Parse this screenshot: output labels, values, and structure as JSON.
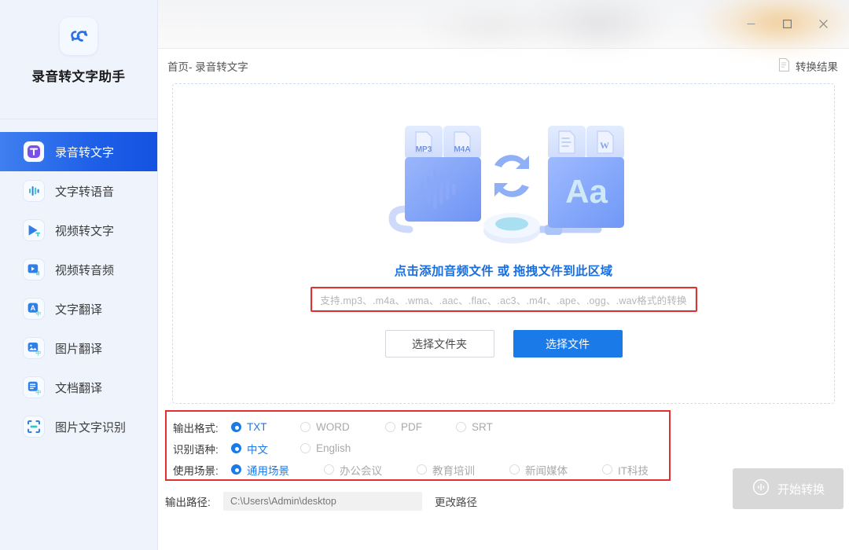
{
  "window": {
    "minimize_icon": "minimize-icon",
    "maximize_icon": "maximize-icon",
    "close_icon": "close-icon"
  },
  "sidebar": {
    "logo_icon": "app-logo-icon",
    "title": "录音转文字助手",
    "items": [
      {
        "label": "录音转文字",
        "icon": "text-transcribe-icon",
        "active": true
      },
      {
        "label": "文字转语音",
        "icon": "waveform-icon",
        "active": false
      },
      {
        "label": "视频转文字",
        "icon": "video-play-icon",
        "active": false
      },
      {
        "label": "视频转音频",
        "icon": "video-audio-icon",
        "active": false
      },
      {
        "label": "文字翻译",
        "icon": "translate-a-icon",
        "active": false
      },
      {
        "label": "图片翻译",
        "icon": "image-translate-icon",
        "active": false
      },
      {
        "label": "文档翻译",
        "icon": "doc-translate-icon",
        "active": false
      },
      {
        "label": "图片文字识别",
        "icon": "scan-ocr-icon",
        "active": false
      }
    ]
  },
  "header": {
    "breadcrumb": "首页- 录音转文字",
    "result_label": "转换结果",
    "result_icon": "document-icon"
  },
  "dropzone": {
    "illustration_labels": {
      "source_1": "MP3",
      "source_2": "M4A",
      "target_1": "doc",
      "target_2": "W",
      "target_text": "Aa"
    },
    "title": "点击添加音频文件 或 拖拽文件到此区域",
    "hint": "支持.mp3、.m4a、.wma、.aac、.flac、.ac3、.m4r、.ape、.ogg、.wav格式的转换",
    "folder_button": "选择文件夹",
    "file_button": "选择文件"
  },
  "options": {
    "format": {
      "label": "输出格式:",
      "choices": [
        {
          "label": "TXT",
          "selected": true,
          "dim": false
        },
        {
          "label": "WORD",
          "selected": false,
          "dim": true
        },
        {
          "label": "PDF",
          "selected": false,
          "dim": true
        },
        {
          "label": "SRT",
          "selected": false,
          "dim": true
        }
      ]
    },
    "language": {
      "label": "识别语种:",
      "choices": [
        {
          "label": "中文",
          "selected": true,
          "dim": false
        },
        {
          "label": "English",
          "selected": false,
          "dim": true
        }
      ]
    },
    "scene": {
      "label": "使用场景:",
      "choices": [
        {
          "label": "通用场景",
          "selected": true,
          "dim": false
        },
        {
          "label": "办公会议",
          "selected": false,
          "dim": true
        },
        {
          "label": "教育培训",
          "selected": false,
          "dim": true
        },
        {
          "label": "新闻媒体",
          "selected": false,
          "dim": true
        },
        {
          "label": "IT科技",
          "selected": false,
          "dim": true
        }
      ]
    },
    "path": {
      "label": "输出路径:",
      "value": "",
      "placeholder": "C:\\Users\\Admin\\desktop",
      "change_label": "更改路径"
    },
    "start_button": {
      "label": "开始转换",
      "icon": "convert-icon",
      "disabled": true
    }
  },
  "colors": {
    "accent": "#1a7ae8",
    "active_nav": "#1e5fe8",
    "highlight_box": "#e03131",
    "sidebar_bg": "#eef3fc",
    "disabled_btn": "#d8d8d8"
  }
}
